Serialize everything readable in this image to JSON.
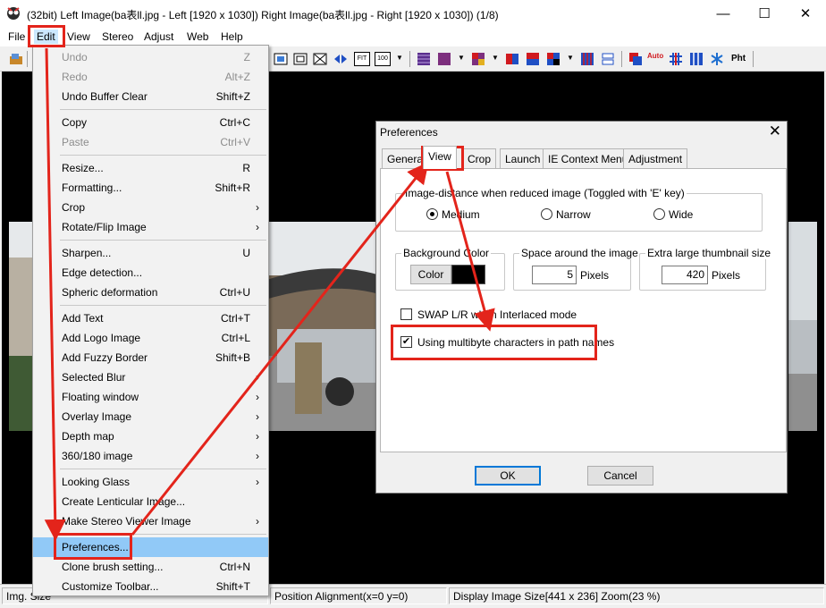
{
  "window": {
    "title": "(32bit) Left Image(ba表ll.jpg - Left [1920 x 1030]) Right Image(ba表ll.jpg - Right [1920 x 1030])  (1/8)",
    "minimize": "—",
    "maximize": "☐",
    "close": "✕"
  },
  "menubar": [
    "File",
    "Edit",
    "View",
    "Stereo",
    "Adjust",
    "Web",
    "Help"
  ],
  "edit_menu": {
    "items": [
      {
        "label": "Undo",
        "shortcut": "Z",
        "disabled": true
      },
      {
        "label": "Redo",
        "shortcut": "Alt+Z",
        "disabled": true
      },
      {
        "label": "Undo Buffer Clear",
        "shortcut": "Shift+Z"
      },
      {
        "label": "Copy",
        "shortcut": "Ctrl+C"
      },
      {
        "label": "Paste",
        "shortcut": "Ctrl+V",
        "disabled": true
      },
      {
        "label": "Resize...",
        "shortcut": "R"
      },
      {
        "label": "Formatting...",
        "shortcut": "Shift+R"
      },
      {
        "label": "Crop",
        "submenu": true
      },
      {
        "label": "Rotate/Flip Image",
        "submenu": true
      },
      {
        "label": "Sharpen...",
        "shortcut": "U"
      },
      {
        "label": "Edge detection..."
      },
      {
        "label": "Spheric deformation",
        "shortcut": "Ctrl+U"
      },
      {
        "label": "Add Text",
        "shortcut": "Ctrl+T"
      },
      {
        "label": "Add Logo Image",
        "shortcut": "Ctrl+L"
      },
      {
        "label": "Add Fuzzy Border",
        "shortcut": "Shift+B"
      },
      {
        "label": "Selected Blur",
        "submenu": true
      },
      {
        "label": "Floating window",
        "submenu": true
      },
      {
        "label": "Overlay Image",
        "submenu": true
      },
      {
        "label": "Depth map",
        "submenu": true
      },
      {
        "label": "360/180 image",
        "submenu": true
      },
      {
        "label": "Looking Glass",
        "submenu": true
      },
      {
        "label": "Create Lenticular Image..."
      },
      {
        "label": "Make Stereo Viewer Image",
        "submenu": true
      },
      {
        "label": "Preferences...",
        "highlighted": true
      },
      {
        "label": "Clone brush setting...",
        "shortcut": "Ctrl+N"
      },
      {
        "label": "Customize Toolbar...",
        "shortcut": "Shift+T"
      }
    ],
    "submenu_arrow": "›"
  },
  "dialog": {
    "title": "Preferences",
    "close": "✕",
    "tabs": [
      "General",
      "View",
      "Crop",
      "Launch",
      "IE Context Menu",
      "Adjustment"
    ],
    "active_tab": "View",
    "distance_group": {
      "title": "Image-distance when reduced image (Toggled with 'E' key)",
      "options": [
        "Medium",
        "Narrow",
        "Wide"
      ],
      "selected": "Medium"
    },
    "background_group": {
      "title": "Background Color",
      "button": "Color",
      "swatch": "#000000"
    },
    "space_group": {
      "title": "Space around the image",
      "value": "5",
      "unit": "Pixels"
    },
    "thumb_group": {
      "title": "Extra large thumbnail size",
      "value": "420",
      "unit": "Pixels"
    },
    "swap_checkbox": {
      "label": "SWAP L/R when Interlaced mode",
      "checked": false,
      "mark": ""
    },
    "multibyte_checkbox": {
      "label": "Using multibyte characters in path names",
      "checked": true,
      "mark": "✔"
    },
    "ok": "OK",
    "cancel": "Cancel"
  },
  "statusbar": {
    "left": "Img. Size",
    "middle": "Position Alignment(x=0 y=0)",
    "right": "Display Image Size[441 x 236]  Zoom(23 %)"
  },
  "toolbar": {
    "auto_label": "Auto",
    "pht_label": "Pht",
    "fit_label": "FIT",
    "hundred_label": "100",
    "drop_glyph": "▼"
  },
  "colors": {
    "annotation_red": "#e3241b",
    "menu_highlight": "#91c9f7"
  }
}
